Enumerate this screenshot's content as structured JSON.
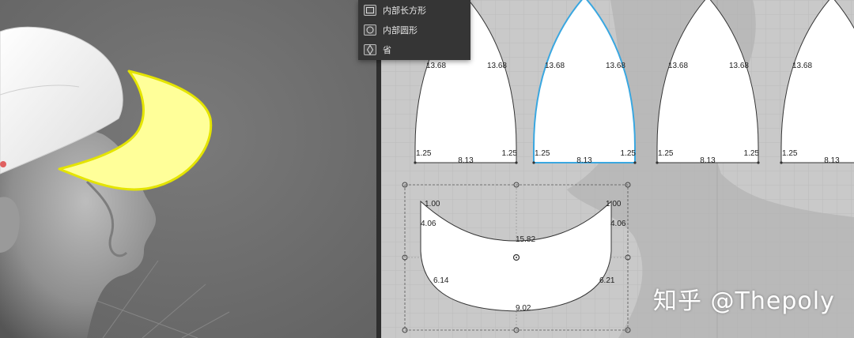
{
  "menu": {
    "items": [
      {
        "label": "内部长方形",
        "icon": "rectangle-icon"
      },
      {
        "label": "内部圆形",
        "icon": "circle-icon"
      },
      {
        "label": "省",
        "icon": "dart-icon"
      }
    ]
  },
  "panels": [
    {
      "top_left": "13.68",
      "top_right": "13.68",
      "bottom_left": "1.25",
      "bottom_right": "1.25",
      "base": "8.13",
      "selected": false
    },
    {
      "top_left": "13.68",
      "top_right": "13.68",
      "bottom_left": "1.25",
      "bottom_right": "1.25",
      "base": "8.13",
      "selected": true
    },
    {
      "top_left": "13.68",
      "top_right": "13.68",
      "bottom_left": "1.25",
      "bottom_right": "1.25",
      "base": "8.13",
      "selected": false
    },
    {
      "top_left": "13.68",
      "top_right": "",
      "bottom_left": "1.25",
      "bottom_right": "",
      "base": "8.13",
      "selected": false
    }
  ],
  "visor": {
    "top_left": "1.00",
    "top_right": "1.00",
    "left_upper": "4.06",
    "right_upper": "4.06",
    "inner_curve": "15.82",
    "left_lower": "6.14",
    "right_lower": "6.21",
    "outer_curve": "9.02"
  },
  "watermark": "知乎 @Thepoly",
  "colors": {
    "selection_blue": "#3aa7e0",
    "visor_highlight": "#ffff99",
    "visor_outline": "#e4e400",
    "canvas_bg": "#c9c9c9",
    "menu_bg": "#353535"
  }
}
